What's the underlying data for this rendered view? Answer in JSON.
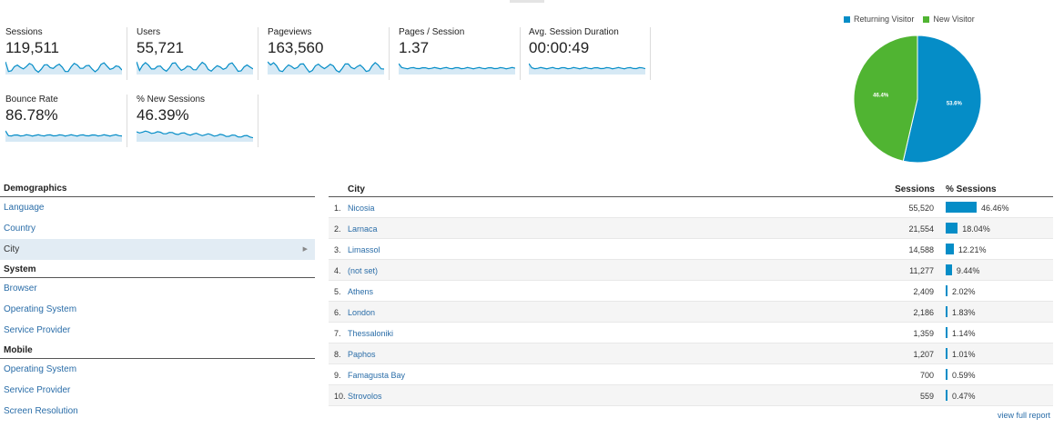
{
  "metrics": [
    {
      "label": "Sessions",
      "value": "119,511"
    },
    {
      "label": "Users",
      "value": "55,721"
    },
    {
      "label": "Pageviews",
      "value": "163,560"
    },
    {
      "label": "Pages / Session",
      "value": "1.37"
    },
    {
      "label": "Avg. Session Duration",
      "value": "00:00:49"
    },
    {
      "label": "Bounce Rate",
      "value": "86.78%"
    },
    {
      "label": "% New Sessions",
      "value": "46.39%"
    }
  ],
  "pie": {
    "legend": [
      {
        "label": "Returning Visitor",
        "color": "#058dc7"
      },
      {
        "label": "New Visitor",
        "color": "#50b432"
      }
    ],
    "slices": [
      {
        "label": "Returning Visitor",
        "value": 53.6,
        "text": "53.6%"
      },
      {
        "label": "New Visitor",
        "value": 46.4,
        "text": "46.4%"
      }
    ]
  },
  "nav": {
    "demographics": "Demographics",
    "language": "Language",
    "country": "Country",
    "city": "City",
    "system": "System",
    "browser": "Browser",
    "os": "Operating System",
    "provider": "Service Provider",
    "mobile": "Mobile",
    "mobile_os": "Operating System",
    "mobile_provider": "Service Provider",
    "screen_res": "Screen Resolution"
  },
  "table": {
    "col_city": "City",
    "col_sessions": "Sessions",
    "col_pct": "% Sessions",
    "rows": [
      {
        "rank": "1.",
        "city": "Nicosia",
        "sessions": "55,520",
        "pct": "46.46%",
        "pct_value": 46.46
      },
      {
        "rank": "2.",
        "city": "Larnaca",
        "sessions": "21,554",
        "pct": "18.04%",
        "pct_value": 18.04
      },
      {
        "rank": "3.",
        "city": "Limassol",
        "sessions": "14,588",
        "pct": "12.21%",
        "pct_value": 12.21
      },
      {
        "rank": "4.",
        "city": "(not set)",
        "sessions": "11,277",
        "pct": "9.44%",
        "pct_value": 9.44
      },
      {
        "rank": "5.",
        "city": "Athens",
        "sessions": "2,409",
        "pct": "2.02%",
        "pct_value": 2.02
      },
      {
        "rank": "6.",
        "city": "London",
        "sessions": "2,186",
        "pct": "1.83%",
        "pct_value": 1.83
      },
      {
        "rank": "7.",
        "city": "Thessaloniki",
        "sessions": "1,359",
        "pct": "1.14%",
        "pct_value": 1.14
      },
      {
        "rank": "8.",
        "city": "Paphos",
        "sessions": "1,207",
        "pct": "1.01%",
        "pct_value": 1.01
      },
      {
        "rank": "9.",
        "city": "Famagusta Bay",
        "sessions": "700",
        "pct": "0.59%",
        "pct_value": 0.59
      },
      {
        "rank": "10.",
        "city": "Strovolos",
        "sessions": "559",
        "pct": "0.47%",
        "pct_value": 0.47
      }
    ],
    "view_full": "view full report"
  },
  "colors": {
    "accent": "#058dc7",
    "accent_fill": "#d6e9f5",
    "new_visitor": "#50b432"
  }
}
